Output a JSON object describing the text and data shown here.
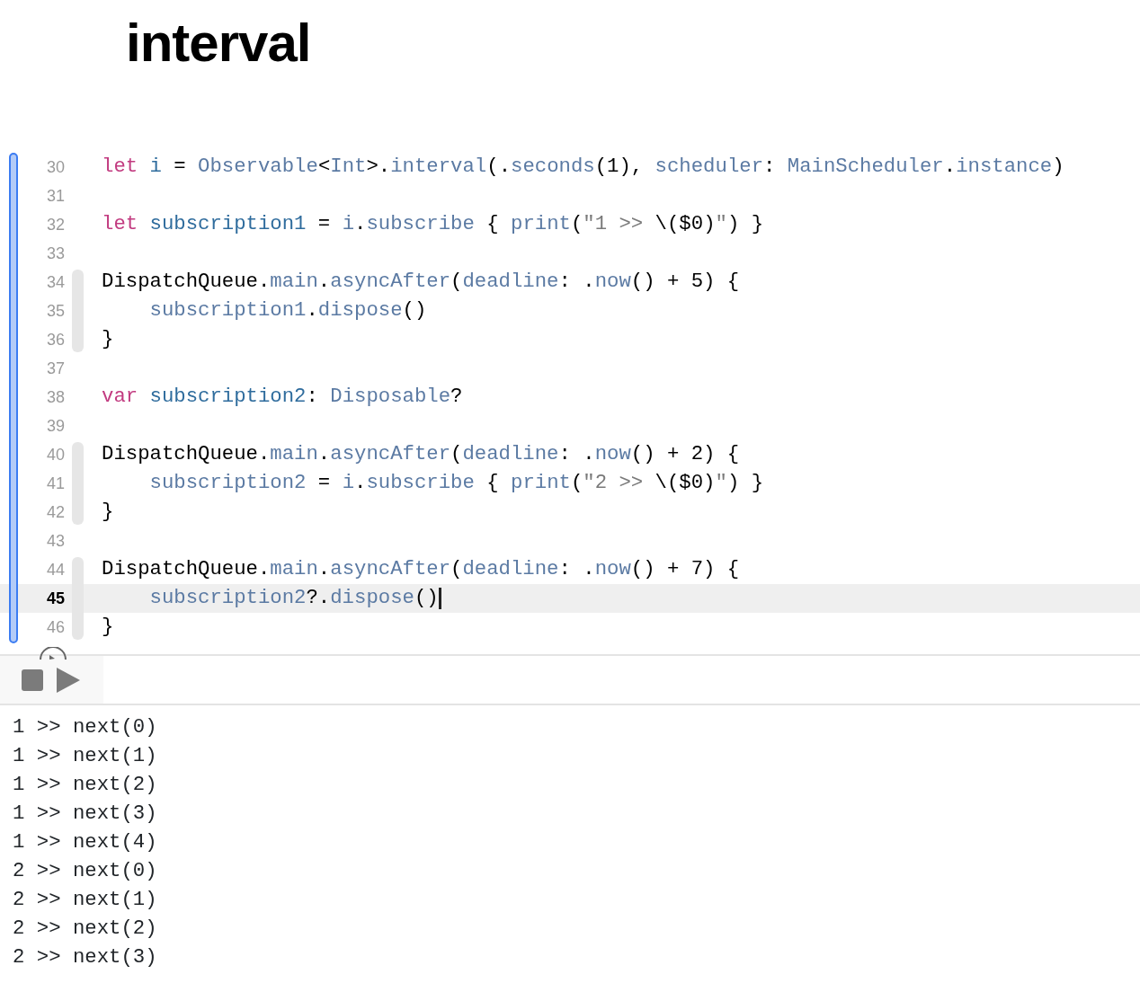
{
  "title": "interval",
  "editor": {
    "lines": [
      {
        "kind": "line",
        "number": "30",
        "current": false,
        "tokens": [
          {
            "kind": "keyword",
            "text": "let"
          },
          {
            "kind": "decl",
            "text": "i"
          },
          {
            "kind": "plain",
            "text": " = "
          },
          {
            "kind": "ref",
            "text": "Observable"
          },
          {
            "kind": "plain",
            "text": "<"
          },
          {
            "kind": "ref",
            "text": "Int"
          },
          {
            "kind": "plain",
            "text": ">."
          },
          {
            "kind": "ref",
            "text": "interval"
          },
          {
            "kind": "plain",
            "text": "(."
          },
          {
            "kind": "ref",
            "text": "seconds"
          },
          {
            "kind": "plain",
            "text": "(1), "
          },
          {
            "kind": "ref",
            "text": "scheduler"
          },
          {
            "kind": "plain",
            "text": ": "
          },
          {
            "kind": "ref",
            "text": "MainScheduler"
          },
          {
            "kind": "plain",
            "text": "."
          },
          {
            "kind": "ref",
            "text": "instance"
          },
          {
            "kind": "plain",
            "text": ")"
          }
        ]
      },
      {
        "kind": "line",
        "number": "31",
        "current": false
      },
      {
        "kind": "line",
        "number": "32",
        "current": false,
        "tokens": [
          {
            "kind": "keyword",
            "text": "let"
          },
          {
            "kind": "decl",
            "text": "subscription1"
          },
          {
            "kind": "plain",
            "text": " = "
          },
          {
            "kind": "ref",
            "text": "i"
          },
          {
            "kind": "plain",
            "text": "."
          },
          {
            "kind": "ref",
            "text": "subscribe"
          },
          {
            "kind": "plain",
            "text": " { "
          },
          {
            "kind": "ref",
            "text": "print"
          },
          {
            "kind": "plain",
            "text": "("
          },
          {
            "kind": "string",
            "text": "\"1 >> "
          },
          {
            "kind": "plain",
            "text": "\\($0)"
          },
          {
            "kind": "string",
            "text": "\""
          },
          {
            "kind": "plain",
            "text": ") }"
          }
        ]
      },
      {
        "kind": "line",
        "number": "33",
        "current": false
      },
      {
        "kind": "block",
        "lines": [
          {
            "kind": "line",
            "number": "34",
            "current": false,
            "tokens": [
              {
                "kind": "plain",
                "text": "DispatchQueue."
              },
              {
                "kind": "ref",
                "text": "main"
              },
              {
                "kind": "plain",
                "text": "."
              },
              {
                "kind": "ref",
                "text": "asyncAfter"
              },
              {
                "kind": "plain",
                "text": "("
              },
              {
                "kind": "ref",
                "text": "deadline"
              },
              {
                "kind": "plain",
                "text": ": ."
              },
              {
                "kind": "ref",
                "text": "now"
              },
              {
                "kind": "plain",
                "text": "() + 5) {"
              }
            ]
          },
          {
            "kind": "line",
            "number": "35",
            "current": false,
            "indent": true,
            "tokens": [
              {
                "kind": "ref",
                "text": "subscription1"
              },
              {
                "kind": "plain",
                "text": "."
              },
              {
                "kind": "ref",
                "text": "dispose"
              },
              {
                "kind": "plain",
                "text": "()"
              }
            ]
          },
          {
            "kind": "line",
            "number": "36",
            "current": false,
            "tokens": [
              {
                "kind": "plain",
                "text": "}"
              }
            ]
          }
        ]
      },
      {
        "kind": "line",
        "number": "37",
        "current": false
      },
      {
        "kind": "line",
        "number": "38",
        "current": false,
        "tokens": [
          {
            "kind": "keyword",
            "text": "var"
          },
          {
            "kind": "decl",
            "text": "subscription2"
          },
          {
            "kind": "plain",
            "text": ": "
          },
          {
            "kind": "ref",
            "text": "Disposable"
          },
          {
            "kind": "plain",
            "text": "?"
          }
        ]
      },
      {
        "kind": "line",
        "number": "39",
        "current": false
      },
      {
        "kind": "block",
        "lines": [
          {
            "kind": "line",
            "number": "40",
            "current": false,
            "tokens": [
              {
                "kind": "plain",
                "text": "DispatchQueue."
              },
              {
                "kind": "ref",
                "text": "main"
              },
              {
                "kind": "plain",
                "text": "."
              },
              {
                "kind": "ref",
                "text": "asyncAfter"
              },
              {
                "kind": "plain",
                "text": "("
              },
              {
                "kind": "ref",
                "text": "deadline"
              },
              {
                "kind": "plain",
                "text": ": ."
              },
              {
                "kind": "ref",
                "text": "now"
              },
              {
                "kind": "plain",
                "text": "() + 2) {"
              }
            ]
          },
          {
            "kind": "line",
            "number": "41",
            "current": false,
            "indent": true,
            "tokens": [
              {
                "kind": "ref",
                "text": "subscription2"
              },
              {
                "kind": "plain",
                "text": " = "
              },
              {
                "kind": "ref",
                "text": "i"
              },
              {
                "kind": "plain",
                "text": "."
              },
              {
                "kind": "ref",
                "text": "subscribe"
              },
              {
                "kind": "plain",
                "text": " { "
              },
              {
                "kind": "ref",
                "text": "print"
              },
              {
                "kind": "plain",
                "text": "("
              },
              {
                "kind": "string",
                "text": "\"2 >> "
              },
              {
                "kind": "plain",
                "text": "\\($0)"
              },
              {
                "kind": "string",
                "text": "\""
              },
              {
                "kind": "plain",
                "text": ") }"
              }
            ]
          },
          {
            "kind": "line",
            "number": "42",
            "current": false,
            "tokens": [
              {
                "kind": "plain",
                "text": "}"
              }
            ]
          }
        ]
      },
      {
        "kind": "line",
        "number": "43",
        "current": false
      },
      {
        "kind": "block",
        "lines": [
          {
            "kind": "line",
            "number": "44",
            "current": false,
            "tokens": [
              {
                "kind": "plain",
                "text": "DispatchQueue."
              },
              {
                "kind": "ref",
                "text": "main"
              },
              {
                "kind": "plain",
                "text": "."
              },
              {
                "kind": "ref",
                "text": "asyncAfter"
              },
              {
                "kind": "plain",
                "text": "("
              },
              {
                "kind": "ref",
                "text": "deadline"
              },
              {
                "kind": "plain",
                "text": ": ."
              },
              {
                "kind": "ref",
                "text": "now"
              },
              {
                "kind": "plain",
                "text": "() + 7) {"
              }
            ]
          },
          {
            "kind": "line",
            "number": "45",
            "current": true,
            "indent": true,
            "tokens": [
              {
                "kind": "ref",
                "text": "subscription2"
              },
              {
                "kind": "plain",
                "text": "?."
              },
              {
                "kind": "ref",
                "text": "dispose"
              },
              {
                "kind": "plain",
                "text": "()"
              }
            ]
          },
          {
            "kind": "line",
            "number": "46",
            "current": false,
            "tokens": [
              {
                "kind": "plain",
                "text": "}"
              }
            ]
          }
        ]
      }
    ]
  },
  "console": [
    "1 >> next(0)",
    "1 >> next(1)",
    "1 >> next(2)",
    "1 >> next(3)",
    "1 >> next(4)",
    "2 >> next(0)",
    "2 >> next(1)",
    "2 >> next(2)",
    "2 >> next(3)"
  ]
}
